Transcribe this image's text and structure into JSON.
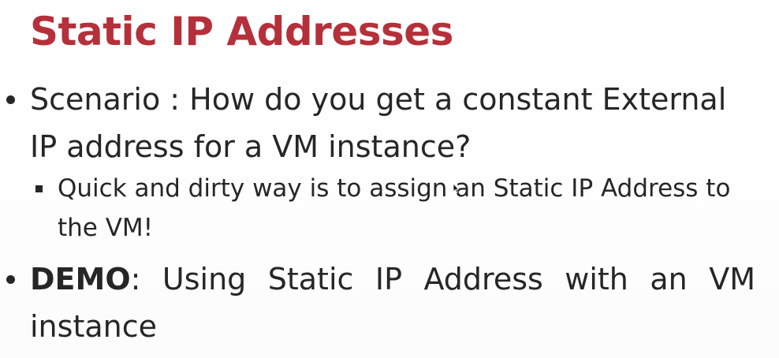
{
  "slide": {
    "title": "Static IP Addresses",
    "bullets": [
      {
        "text": "Scenario : How do you get a constant External IP address for a VM instance?"
      },
      {
        "text": "Quick and dirty way is to assign an Static IP Address to the VM!"
      },
      {
        "bold": "DEMO",
        "text": ": Using Static IP Address with an VM instance"
      }
    ]
  }
}
